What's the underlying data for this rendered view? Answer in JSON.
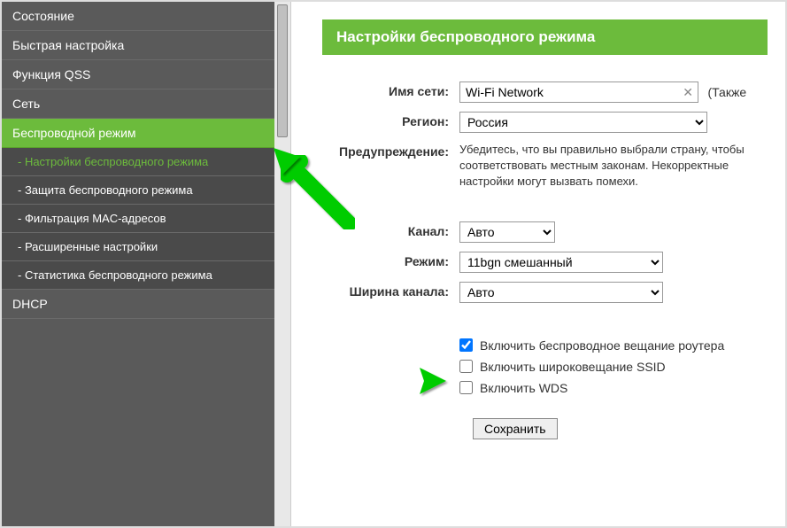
{
  "sidebar": {
    "items": [
      {
        "label": "Состояние"
      },
      {
        "label": "Быстрая настройка"
      },
      {
        "label": "Функция QSS"
      },
      {
        "label": "Сеть"
      },
      {
        "label": "Беспроводной режим"
      },
      {
        "label": "- Настройки беспроводного режима"
      },
      {
        "label": "- Защита беспроводного режима"
      },
      {
        "label": "- Фильтрация MAC-адресов"
      },
      {
        "label": "- Расширенные настройки"
      },
      {
        "label": "- Статистика беспроводного режима"
      },
      {
        "label": "DHCP"
      }
    ]
  },
  "page": {
    "title": "Настройки беспроводного режима"
  },
  "form": {
    "ssid_label": "Имя сети:",
    "ssid_value": "Wi-Fi Network",
    "also": "(Также",
    "region_label": "Регион:",
    "region_value": "Россия",
    "warning_label": "Предупреждение:",
    "warning_text": "Убедитесь, что вы правильно выбрали страну, чтобы соответствовать местным законам. Некорректные настройки могут вызвать помехи.",
    "channel_label": "Канал:",
    "channel_value": "Авто",
    "mode_label": "Режим:",
    "mode_value": "11bgn смешанный",
    "width_label": "Ширина канала:",
    "width_value": "Авто",
    "cb_broadcast": "Включить беспроводное вещание роутера",
    "cb_ssid": "Включить широковещание SSID",
    "cb_wds": "Включить WDS",
    "save": "Сохранить"
  }
}
